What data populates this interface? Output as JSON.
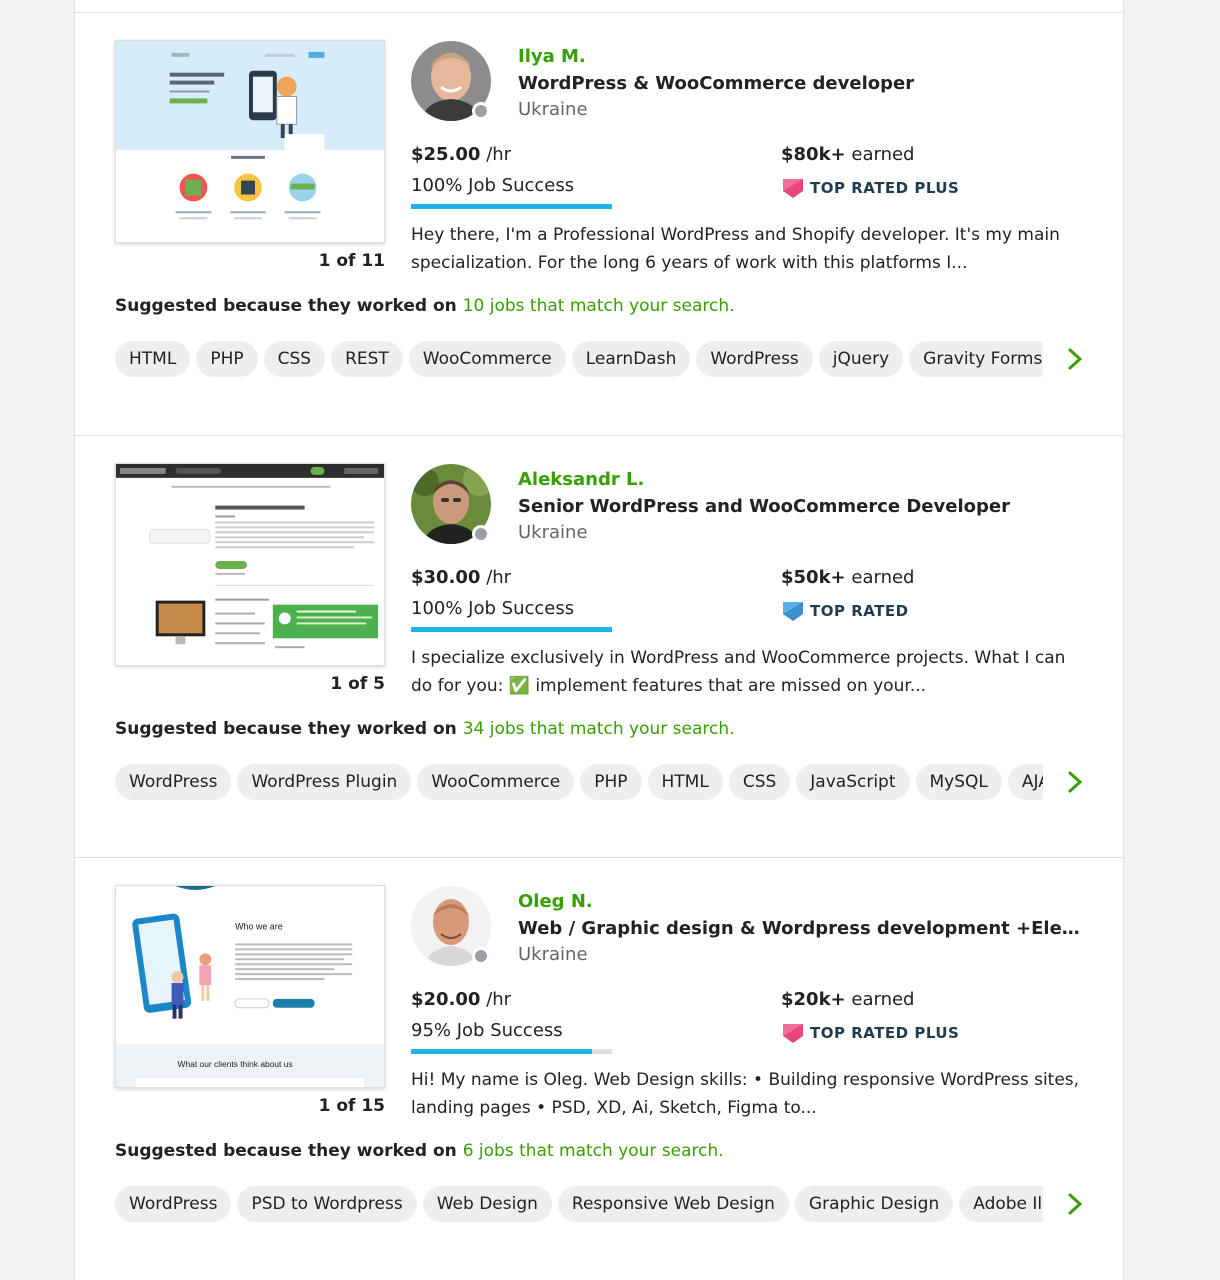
{
  "colors": {
    "accent_green": "#37a000",
    "progress_blue": "#1cb5e8",
    "top_rated_plus": "#e8457a",
    "top_rated": "#3a8fd1"
  },
  "freelancers": [
    {
      "portfolio_counter": "1 of 11",
      "name": "Ilya M.",
      "title": "WordPress & WooCommerce developer",
      "country": "Ukraine",
      "rate": "$25.00",
      "rate_unit": "/hr",
      "job_success": "100% Job Success",
      "job_success_pct": 100,
      "earned_amount": "$80k+",
      "earned_label": "earned",
      "badge": "TOP RATED PLUS",
      "badge_icon": "top-rated-plus-icon",
      "description": "Hey there, I'm a Professional WordPress and Shopify developer. It's my main specialization. For the long 6 years of work with this platforms I...",
      "suggested_prefix": "Suggested because they worked on",
      "suggested_link": "10 jobs that match your search.",
      "skills": [
        "HTML",
        "PHP",
        "CSS",
        "REST",
        "WooCommerce",
        "LearnDash",
        "WordPress",
        "jQuery",
        "Gravity Forms"
      ]
    },
    {
      "portfolio_counter": "1 of 5",
      "name": "Aleksandr L.",
      "title": "Senior WordPress and WooCommerce Developer",
      "country": "Ukraine",
      "rate": "$30.00",
      "rate_unit": "/hr",
      "job_success": "100% Job Success",
      "job_success_pct": 100,
      "earned_amount": "$50k+",
      "earned_label": "earned",
      "badge": "TOP RATED",
      "badge_icon": "top-rated-icon",
      "description": "I specialize exclusively in WordPress and WooCommerce projects. What I can do for you: ✅ implement features that are missed on your...",
      "suggested_prefix": "Suggested because they worked on",
      "suggested_link": "34 jobs that match your search.",
      "skills": [
        "WordPress",
        "WordPress Plugin",
        "WooCommerce",
        "PHP",
        "HTML",
        "CSS",
        "JavaScript",
        "MySQL",
        "AJAX"
      ]
    },
    {
      "portfolio_counter": "1 of 15",
      "name": "Oleg N.",
      "title": "Web / Graphic design & Wordpress development +Elementor",
      "country": "Ukraine",
      "rate": "$20.00",
      "rate_unit": "/hr",
      "job_success": "95% Job Success",
      "job_success_pct": 90,
      "earned_amount": "$20k+",
      "earned_label": "earned",
      "badge": "TOP RATED PLUS",
      "badge_icon": "top-rated-plus-icon",
      "description": "Hi! My name is Oleg. Web Design skills: • Building responsive WordPress sites, landing pages • PSD, XD, Ai, Sketch, Figma to...",
      "suggested_prefix": "Suggested because they worked on",
      "suggested_link": "6 jobs that match your search.",
      "skills": [
        "WordPress",
        "PSD to Wordpress",
        "Web Design",
        "Responsive Web Design",
        "Graphic Design",
        "Adobe Illustrator"
      ]
    }
  ],
  "thumbnail_texts": {
    "t3_heading": "Who we are",
    "t3_footer": "What our clients think about us"
  }
}
